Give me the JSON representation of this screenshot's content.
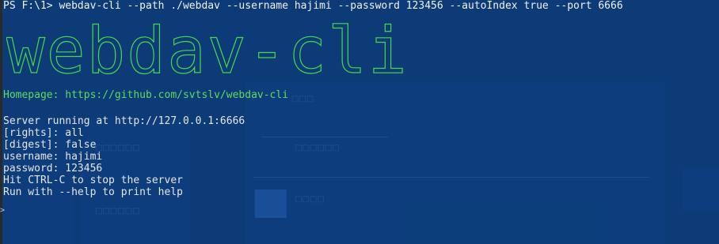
{
  "terminal": {
    "command_line": "PS F:\\1> webdav-cli --path ./webdav --username hajimi --password 123456 --autoIndex true --port 6666",
    "banner_text": "webdav-cli",
    "homepage_line": "Homepage: https://github.com/svtslv/webdav-cli",
    "status_lines": [
      "Server running at http://127.0.0.1:6666",
      "[rights]: all",
      "[digest]: false",
      "username: hajimi",
      "password: 123456",
      "Hit CTRL-C to stop the server",
      "Run with --help to print help"
    ],
    "prompt_marker": ">"
  },
  "colors": {
    "background": "#0c3b78",
    "text": "#e6e6e6",
    "accent_green": "#49d749"
  }
}
